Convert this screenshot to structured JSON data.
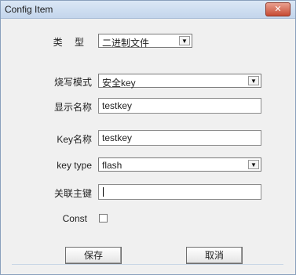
{
  "window": {
    "title": "Config Item",
    "close_glyph": "✕"
  },
  "form": {
    "type_label": "类 型",
    "type_value": "二进制文件",
    "write_mode_label": "烧写模式",
    "write_mode_value": "安全key",
    "display_name_label": "显示名称",
    "display_name_value": "testkey",
    "key_name_label": "Key名称",
    "key_name_value": "testkey",
    "key_type_label": "key type",
    "key_type_value": "flash",
    "primary_key_label": "关联主键",
    "primary_key_value": "",
    "const_label": "Const",
    "const_checked": false
  },
  "buttons": {
    "save": "保存",
    "cancel": "取消"
  },
  "icons": {
    "dropdown": "▼"
  },
  "colors": {
    "titlebar": "#c3d5ec",
    "close": "#c74b34",
    "window_bg": "#f0f0f0"
  }
}
